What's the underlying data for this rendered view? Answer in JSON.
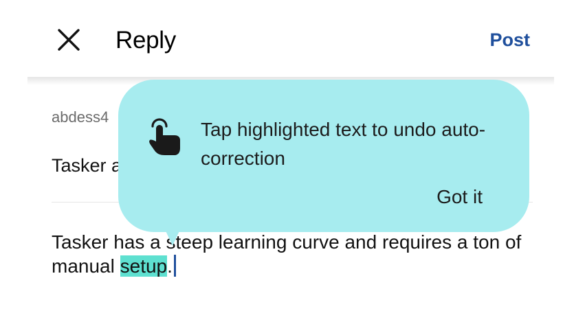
{
  "header": {
    "title": "Reply",
    "post_label": "Post",
    "close_icon": "close-icon",
    "post_color": "#1f4f9c"
  },
  "parent_post": {
    "username": "abdess4",
    "text": "Tasker a"
  },
  "reply": {
    "text_before": "Tasker has a steep learning curve and requires a ton of manual ",
    "highlighted_word": "setup",
    "text_after": ".",
    "highlight_color": "#5ee0d0"
  },
  "tooltip": {
    "message": "Tap highlighted text to undo auto-correction",
    "dismiss_label": "Got it",
    "icon": "tap-gesture-icon",
    "background": "#a7ecef"
  }
}
